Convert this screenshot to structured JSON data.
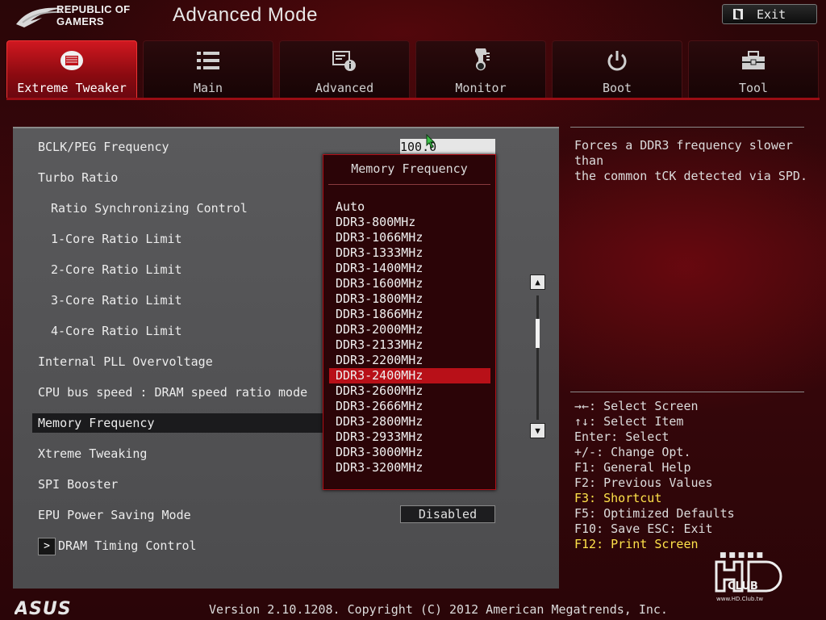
{
  "header": {
    "brand_line1": "REPUBLIC OF",
    "brand_line2": "GAMERS",
    "mode_title": "Advanced Mode",
    "exit_label": "Exit"
  },
  "tabs": [
    {
      "label": "Extreme Tweaker",
      "icon": "extreme-tweaker-icon",
      "active": true
    },
    {
      "label": "Main",
      "icon": "list-icon",
      "active": false
    },
    {
      "label": "Advanced",
      "icon": "advanced-settings-icon",
      "active": false
    },
    {
      "label": "Monitor",
      "icon": "thermometer-icon",
      "active": false
    },
    {
      "label": "Boot",
      "icon": "power-icon",
      "active": false
    },
    {
      "label": "Tool",
      "icon": "toolbox-icon",
      "active": false
    }
  ],
  "settings": {
    "bclk": {
      "label": "BCLK/PEG Frequency",
      "value": "100.0"
    },
    "turbo_ratio": "Turbo Ratio",
    "ratio_sync": "Ratio Synchronizing Control",
    "core1": "1-Core Ratio Limit",
    "core2": "2-Core Ratio Limit",
    "core3": "3-Core Ratio Limit",
    "core4": "4-Core Ratio Limit",
    "pll": "Internal PLL Overvoltage",
    "cpu_bus": "CPU bus speed : DRAM speed ratio mode",
    "mem_freq": "Memory Frequency",
    "xtreme": "Xtreme Tweaking",
    "spi": "SPI Booster",
    "epu": {
      "label": "EPU Power Saving Mode",
      "value": "Disabled"
    },
    "dram_timing": "DRAM Timing Control",
    "submenu_arrow": ">"
  },
  "popup": {
    "title": "Memory Frequency",
    "options": [
      "Auto",
      "DDR3-800MHz",
      "DDR3-1066MHz",
      "DDR3-1333MHz",
      "DDR3-1400MHz",
      "DDR3-1600MHz",
      "DDR3-1800MHz",
      "DDR3-1866MHz",
      "DDR3-2000MHz",
      "DDR3-2133MHz",
      "DDR3-2200MHz",
      "DDR3-2400MHz",
      "DDR3-2600MHz",
      "DDR3-2666MHz",
      "DDR3-2800MHz",
      "DDR3-2933MHz",
      "DDR3-3000MHz",
      "DDR3-3200MHz"
    ],
    "selected": "DDR3-2400MHz"
  },
  "help": {
    "line1": "Forces a DDR3 frequency slower than",
    "line2": "the common tCK detected via SPD."
  },
  "keys": [
    {
      "text": "→←: Select Screen",
      "highlight": false
    },
    {
      "text": "↑↓: Select Item",
      "highlight": false
    },
    {
      "text": "Enter: Select",
      "highlight": false
    },
    {
      "text": "+/-: Change Opt.",
      "highlight": false
    },
    {
      "text": "F1: General Help",
      "highlight": false
    },
    {
      "text": "F2: Previous Values",
      "highlight": false
    },
    {
      "text": "F3: Shortcut",
      "highlight": true
    },
    {
      "text": "F5: Optimized Defaults",
      "highlight": false
    },
    {
      "text": "F10: Save  ESC: Exit",
      "highlight": false
    },
    {
      "text": "F12: Print Screen",
      "highlight": true
    }
  ],
  "footer": {
    "brand": "ASUS",
    "version": "Version 2.10.1208. Copyright (C) 2012 American Megatrends, Inc."
  },
  "watermark": {
    "text": "HD CLUB",
    "url": "www.HD.Club.tw"
  },
  "colors": {
    "accent": "#b81018",
    "highlight_key": "#ffe24a",
    "panel": "#525254"
  }
}
